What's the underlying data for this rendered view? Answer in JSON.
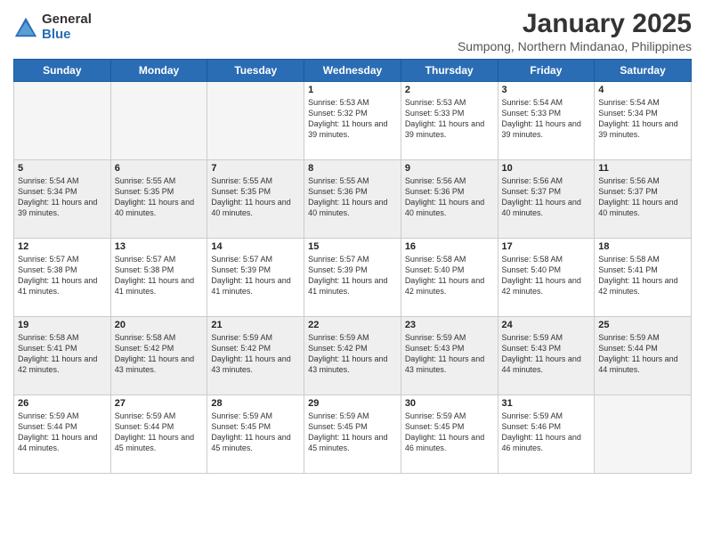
{
  "logo": {
    "general": "General",
    "blue": "Blue"
  },
  "title": "January 2025",
  "subtitle": "Sumpong, Northern Mindanao, Philippines",
  "headers": [
    "Sunday",
    "Monday",
    "Tuesday",
    "Wednesday",
    "Thursday",
    "Friday",
    "Saturday"
  ],
  "weeks": [
    [
      {
        "day": "",
        "sunrise": "",
        "sunset": "",
        "daylight": "",
        "empty": true
      },
      {
        "day": "",
        "sunrise": "",
        "sunset": "",
        "daylight": "",
        "empty": true
      },
      {
        "day": "",
        "sunrise": "",
        "sunset": "",
        "daylight": "",
        "empty": true
      },
      {
        "day": "1",
        "sunrise": "Sunrise: 5:53 AM",
        "sunset": "Sunset: 5:32 PM",
        "daylight": "Daylight: 11 hours and 39 minutes."
      },
      {
        "day": "2",
        "sunrise": "Sunrise: 5:53 AM",
        "sunset": "Sunset: 5:33 PM",
        "daylight": "Daylight: 11 hours and 39 minutes."
      },
      {
        "day": "3",
        "sunrise": "Sunrise: 5:54 AM",
        "sunset": "Sunset: 5:33 PM",
        "daylight": "Daylight: 11 hours and 39 minutes."
      },
      {
        "day": "4",
        "sunrise": "Sunrise: 5:54 AM",
        "sunset": "Sunset: 5:34 PM",
        "daylight": "Daylight: 11 hours and 39 minutes."
      }
    ],
    [
      {
        "day": "5",
        "sunrise": "Sunrise: 5:54 AM",
        "sunset": "Sunset: 5:34 PM",
        "daylight": "Daylight: 11 hours and 39 minutes."
      },
      {
        "day": "6",
        "sunrise": "Sunrise: 5:55 AM",
        "sunset": "Sunset: 5:35 PM",
        "daylight": "Daylight: 11 hours and 40 minutes."
      },
      {
        "day": "7",
        "sunrise": "Sunrise: 5:55 AM",
        "sunset": "Sunset: 5:35 PM",
        "daylight": "Daylight: 11 hours and 40 minutes."
      },
      {
        "day": "8",
        "sunrise": "Sunrise: 5:55 AM",
        "sunset": "Sunset: 5:36 PM",
        "daylight": "Daylight: 11 hours and 40 minutes."
      },
      {
        "day": "9",
        "sunrise": "Sunrise: 5:56 AM",
        "sunset": "Sunset: 5:36 PM",
        "daylight": "Daylight: 11 hours and 40 minutes."
      },
      {
        "day": "10",
        "sunrise": "Sunrise: 5:56 AM",
        "sunset": "Sunset: 5:37 PM",
        "daylight": "Daylight: 11 hours and 40 minutes."
      },
      {
        "day": "11",
        "sunrise": "Sunrise: 5:56 AM",
        "sunset": "Sunset: 5:37 PM",
        "daylight": "Daylight: 11 hours and 40 minutes."
      }
    ],
    [
      {
        "day": "12",
        "sunrise": "Sunrise: 5:57 AM",
        "sunset": "Sunset: 5:38 PM",
        "daylight": "Daylight: 11 hours and 41 minutes."
      },
      {
        "day": "13",
        "sunrise": "Sunrise: 5:57 AM",
        "sunset": "Sunset: 5:38 PM",
        "daylight": "Daylight: 11 hours and 41 minutes."
      },
      {
        "day": "14",
        "sunrise": "Sunrise: 5:57 AM",
        "sunset": "Sunset: 5:39 PM",
        "daylight": "Daylight: 11 hours and 41 minutes."
      },
      {
        "day": "15",
        "sunrise": "Sunrise: 5:57 AM",
        "sunset": "Sunset: 5:39 PM",
        "daylight": "Daylight: 11 hours and 41 minutes."
      },
      {
        "day": "16",
        "sunrise": "Sunrise: 5:58 AM",
        "sunset": "Sunset: 5:40 PM",
        "daylight": "Daylight: 11 hours and 42 minutes."
      },
      {
        "day": "17",
        "sunrise": "Sunrise: 5:58 AM",
        "sunset": "Sunset: 5:40 PM",
        "daylight": "Daylight: 11 hours and 42 minutes."
      },
      {
        "day": "18",
        "sunrise": "Sunrise: 5:58 AM",
        "sunset": "Sunset: 5:41 PM",
        "daylight": "Daylight: 11 hours and 42 minutes."
      }
    ],
    [
      {
        "day": "19",
        "sunrise": "Sunrise: 5:58 AM",
        "sunset": "Sunset: 5:41 PM",
        "daylight": "Daylight: 11 hours and 42 minutes."
      },
      {
        "day": "20",
        "sunrise": "Sunrise: 5:58 AM",
        "sunset": "Sunset: 5:42 PM",
        "daylight": "Daylight: 11 hours and 43 minutes."
      },
      {
        "day": "21",
        "sunrise": "Sunrise: 5:59 AM",
        "sunset": "Sunset: 5:42 PM",
        "daylight": "Daylight: 11 hours and 43 minutes."
      },
      {
        "day": "22",
        "sunrise": "Sunrise: 5:59 AM",
        "sunset": "Sunset: 5:42 PM",
        "daylight": "Daylight: 11 hours and 43 minutes."
      },
      {
        "day": "23",
        "sunrise": "Sunrise: 5:59 AM",
        "sunset": "Sunset: 5:43 PM",
        "daylight": "Daylight: 11 hours and 43 minutes."
      },
      {
        "day": "24",
        "sunrise": "Sunrise: 5:59 AM",
        "sunset": "Sunset: 5:43 PM",
        "daylight": "Daylight: 11 hours and 44 minutes."
      },
      {
        "day": "25",
        "sunrise": "Sunrise: 5:59 AM",
        "sunset": "Sunset: 5:44 PM",
        "daylight": "Daylight: 11 hours and 44 minutes."
      }
    ],
    [
      {
        "day": "26",
        "sunrise": "Sunrise: 5:59 AM",
        "sunset": "Sunset: 5:44 PM",
        "daylight": "Daylight: 11 hours and 44 minutes."
      },
      {
        "day": "27",
        "sunrise": "Sunrise: 5:59 AM",
        "sunset": "Sunset: 5:44 PM",
        "daylight": "Daylight: 11 hours and 45 minutes."
      },
      {
        "day": "28",
        "sunrise": "Sunrise: 5:59 AM",
        "sunset": "Sunset: 5:45 PM",
        "daylight": "Daylight: 11 hours and 45 minutes."
      },
      {
        "day": "29",
        "sunrise": "Sunrise: 5:59 AM",
        "sunset": "Sunset: 5:45 PM",
        "daylight": "Daylight: 11 hours and 45 minutes."
      },
      {
        "day": "30",
        "sunrise": "Sunrise: 5:59 AM",
        "sunset": "Sunset: 5:45 PM",
        "daylight": "Daylight: 11 hours and 46 minutes."
      },
      {
        "day": "31",
        "sunrise": "Sunrise: 5:59 AM",
        "sunset": "Sunset: 5:46 PM",
        "daylight": "Daylight: 11 hours and 46 minutes."
      },
      {
        "day": "",
        "sunrise": "",
        "sunset": "",
        "daylight": "",
        "empty": true
      }
    ]
  ]
}
